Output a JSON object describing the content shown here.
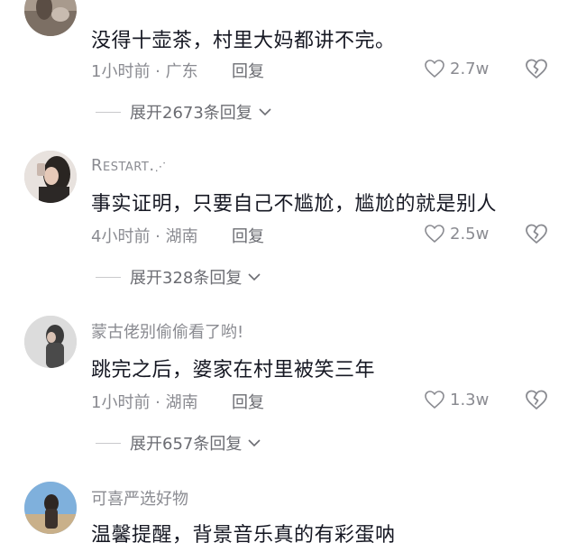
{
  "comments": [
    {
      "username": "",
      "text": "没得十壶茶，村里大妈都讲不完。",
      "time_location": "1小时前 · 广东",
      "reply_label": "回复",
      "likes": "2.7w",
      "expand_label": "展开2673条回复"
    },
    {
      "username": "Restart.",
      "username_suffix": "⋰",
      "text": "事实证明，只要自己不尴尬，尴尬的就是别人",
      "time_location": "4小时前 · 湖南",
      "reply_label": "回复",
      "likes": "2.5w",
      "expand_label": "展开328条回复"
    },
    {
      "username": "蒙古佬别偷偷看了哟!",
      "text": "跳完之后，婆家在村里被笑三年",
      "time_location": "1小时前 · 湖南",
      "reply_label": "回复",
      "likes": "1.3w",
      "expand_label": "展开657条回复"
    },
    {
      "username": "可喜严选好物",
      "text": "温馨提醒，背景音乐真的有彩蛋呐"
    }
  ],
  "icons": {
    "like": "heart-outline-icon",
    "dislike": "broken-heart-icon",
    "expand": "chevron-down-icon"
  },
  "colors": {
    "text": "#161823",
    "secondary": "#8a8b91",
    "background": "#ffffff"
  }
}
